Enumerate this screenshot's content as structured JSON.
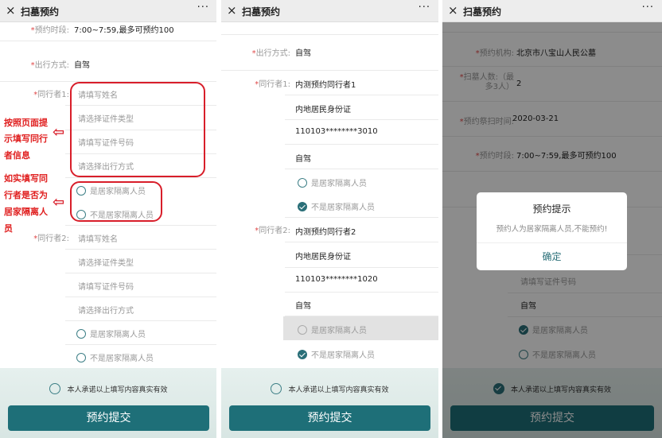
{
  "app": {
    "title": "扫墓预约",
    "close": "×",
    "more": "···",
    "required": "*"
  },
  "panel1": {
    "time_slot": {
      "label": "预约时段:",
      "value": "7:00~7:59,最多可预约100"
    },
    "travel": {
      "label": "出行方式:",
      "value": "自驾"
    },
    "companion1": {
      "label": "同行者1:",
      "name_ph": "请填写姓名",
      "idtype_ph": "请选择证件类型",
      "idno_ph": "请填写证件号码",
      "travel_ph": "请选择出行方式",
      "q_yes": "是居家隔离人员",
      "q_no": "不是居家隔离人员"
    },
    "companion2": {
      "label": "同行者2:",
      "name_ph": "请填写姓名",
      "idtype_ph": "请选择证件类型",
      "idno_ph": "请填写证件号码",
      "travel_ph": "请选择出行方式",
      "q_yes": "是居家隔离人员",
      "q_no": "不是居家隔离人员"
    },
    "annotation1": [
      "按照页面提",
      "示填写同行",
      "者信息"
    ],
    "annotation2": [
      "如实填写同",
      "行者是否为",
      "居家隔离人",
      "员"
    ]
  },
  "panel2": {
    "travel": {
      "label": "出行方式:",
      "value": "自驾"
    },
    "companion1": {
      "label": "同行者1:",
      "name": "内测预约同行者1",
      "idtype": "内地居民身份证",
      "idno": "110103********3010",
      "travel": "自驾",
      "q_yes": "是居家隔离人员",
      "q_no": "不是居家隔离人员"
    },
    "companion2": {
      "label": "同行者2:",
      "name": "内测预约同行者2",
      "idtype": "内地居民身份证",
      "idno": "110103********1020",
      "travel": "自驾",
      "q_yes": "是居家隔离人员",
      "q_no": "不是居家隔离人员"
    }
  },
  "panel3": {
    "org": {
      "label": "预约机构:",
      "value": "北京市八宝山人民公墓"
    },
    "count": {
      "label1": "扫墓人数:（最",
      "label2": "多3人）",
      "value": "2"
    },
    "date": {
      "label": "预约祭扫时间:",
      "value": "2020-03-21"
    },
    "time_slot": {
      "label": "预约时段:",
      "value": "7:00~7:59,最多可预约100"
    },
    "idno_ph": "请填写证件号码",
    "travel": "自驾",
    "q_yes": "是居家隔离人员",
    "q_no": "不是居家隔离人员",
    "dialog": {
      "title": "预约提示",
      "message": "预约人为居家隔离人员,不能预约!",
      "ok": "确定"
    }
  },
  "footer": {
    "agree": "本人承诺以上填写内容真实有效",
    "submit": "预约提交"
  }
}
